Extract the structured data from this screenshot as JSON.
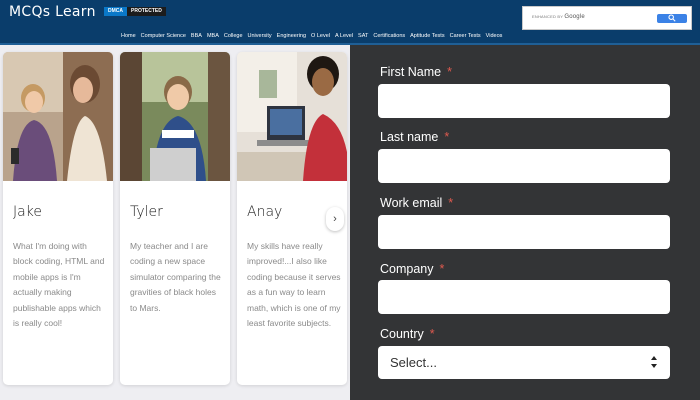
{
  "header": {
    "logo": "MCQs Learn",
    "badge_left": "DMCA",
    "badge_right": "PROTECTED",
    "search": {
      "enhanced_by": "ENHANCED BY",
      "brand": "Google",
      "button_icon": "search-icon"
    },
    "nav": [
      "Home",
      "Computer Science",
      "BBA",
      "MBA",
      "College",
      "University",
      "Engineering",
      "O Level",
      "A Level",
      "SAT",
      "Certifications",
      "Aptitude Tests",
      "Career Tests",
      "Videos"
    ]
  },
  "cards": [
    {
      "name": "Jake",
      "text": "What I'm doing with block coding, HTML and mobile apps is I'm actually making publishable apps which is really cool!"
    },
    {
      "name": "Tyler",
      "text": "My teacher and I are coding a new space simulator comparing the gravities of black holes to Mars."
    },
    {
      "name": "Anay",
      "text": "My skills have really improved!...I also like coding because it serves as a fun way to learn math, which is one of my least favorite subjects."
    }
  ],
  "carousel": {
    "next_icon": "chevron-right-icon",
    "next_glyph": "›"
  },
  "form": {
    "required_mark": "*",
    "first_name_label": "First Name",
    "last_name_label": "Last name",
    "work_email_label": "Work email",
    "company_label": "Company",
    "country_label": "Country",
    "country_value": "Select..."
  },
  "colors": {
    "header_bg": "#0a3d6b",
    "form_bg": "#333436",
    "required": "#e05a4f",
    "search_button": "#3b82e6"
  }
}
